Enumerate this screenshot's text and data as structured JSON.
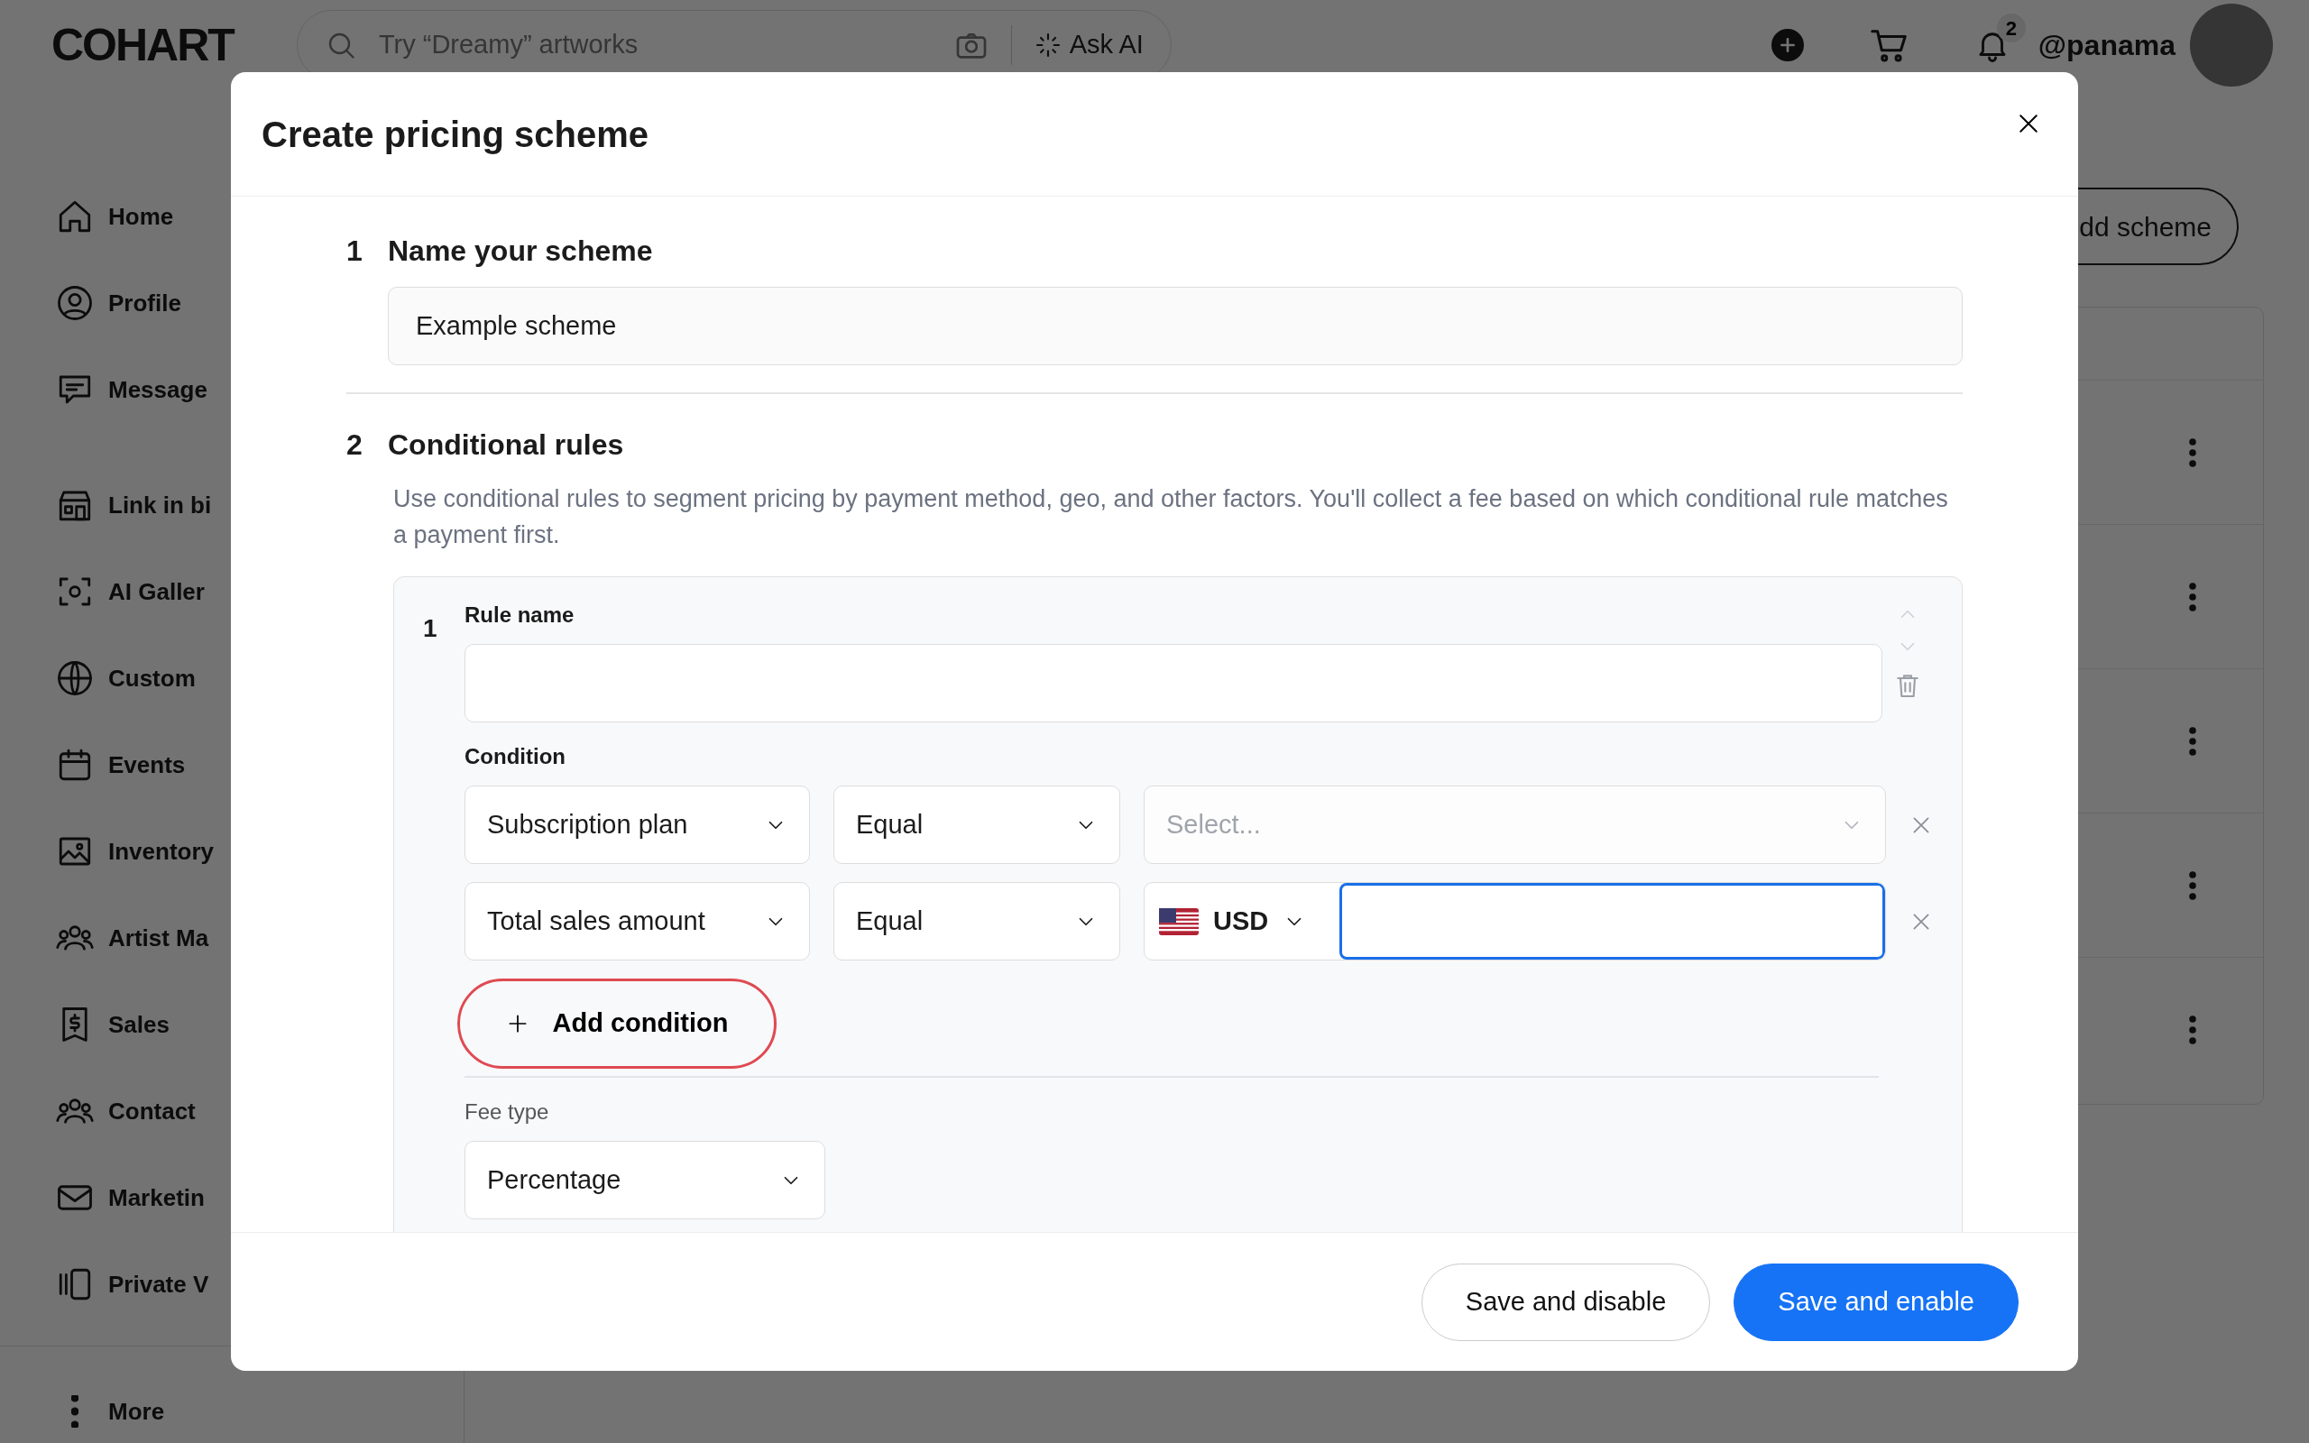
{
  "app": {
    "logo": "COHART",
    "search": {
      "placeholder": "Try “Dreamy” artworks"
    },
    "ask_ai": "Ask AI",
    "notification_badge": "2",
    "username": "@panama",
    "sidebar": {
      "items": [
        {
          "label": "Home"
        },
        {
          "label": "Profile"
        },
        {
          "label": "Message"
        },
        {
          "label": "Link in bi"
        },
        {
          "label": "AI Galler"
        },
        {
          "label": "Custom"
        },
        {
          "label": "Events"
        },
        {
          "label": "Inventory"
        },
        {
          "label": "Artist Ma"
        },
        {
          "label": "Sales"
        },
        {
          "label": "Contact"
        },
        {
          "label": "Marketin"
        },
        {
          "label": "Private V"
        }
      ],
      "more": "More"
    },
    "add_scheme_button": "dd scheme"
  },
  "modal": {
    "title": "Create pricing scheme",
    "sections": [
      {
        "number": "1",
        "title": "Name your scheme",
        "name_field": {
          "value": "Example scheme"
        }
      },
      {
        "number": "2",
        "title": "Conditional rules",
        "description": "Use conditional rules to segment pricing by payment method, geo, and other factors. You'll collect a fee based on which conditional rule matches a payment first.",
        "rules": [
          {
            "number": "1",
            "name_label": "Rule name",
            "condition_label": "Condition",
            "conditions": [
              {
                "field": "Subscription plan",
                "operator": "Equal",
                "value": {
                  "kind": "select",
                  "placeholder": "Select..."
                }
              },
              {
                "field": "Total sales amount",
                "operator": "Equal",
                "value": {
                  "kind": "currency",
                  "currency": "USD",
                  "focused": true
                }
              }
            ],
            "add_condition": {
              "label": "Add condition",
              "highlighted": true
            },
            "fee_type_label": "Fee type",
            "fee_type": "Percentage"
          }
        ]
      }
    ],
    "buttons": [
      {
        "label": "Save and disable",
        "kind": "secondary"
      },
      {
        "label": "Save and enable",
        "kind": "primary"
      }
    ]
  }
}
